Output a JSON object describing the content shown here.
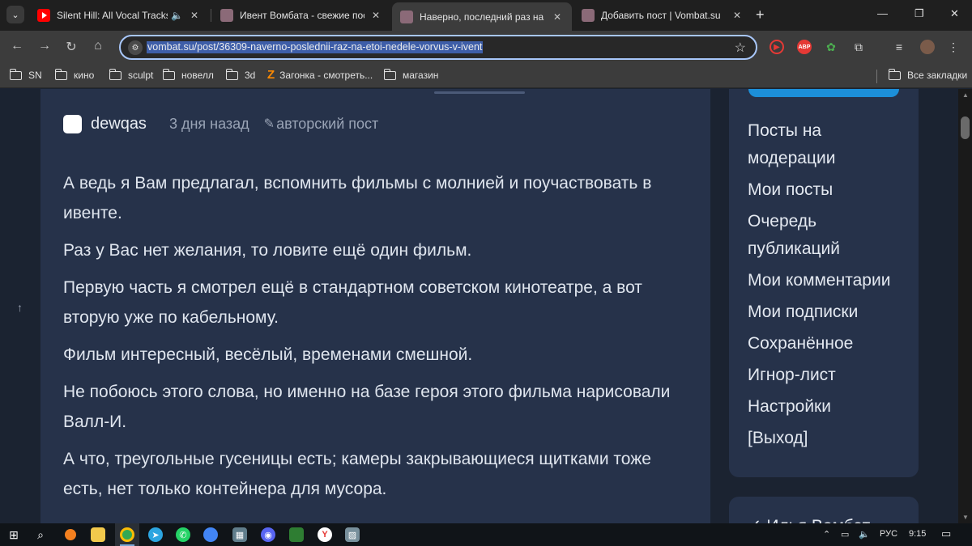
{
  "browser": {
    "tabs": [
      {
        "title": "Silent Hill: All Vocal Tracks -",
        "favicon": "youtube-icon",
        "audio": "speaker-icon"
      },
      {
        "title": "Ивент Вомбата - свежие посты",
        "favicon": "wombat-icon"
      },
      {
        "title": "Наверно, последний раз на эт",
        "favicon": "wombat-icon",
        "active": true
      },
      {
        "title": "Добавить пост | Vombat.su",
        "favicon": "wombat-icon"
      }
    ],
    "close_glyph": "✕",
    "new_tab_glyph": "+",
    "window_controls": [
      "—",
      "❐",
      "✕"
    ],
    "url": "vombat.su/post/36309-naverno-poslednii-raz-na-etoi-nedele-vorvus-v-ivent",
    "bookmarks": [
      "SN",
      "кино",
      "sculpt",
      "новелл",
      "3d",
      "Загонка - смотреть...",
      "магазин"
    ],
    "all_bookmarks": "Все закладки",
    "extensions": {
      "abp": "ABP"
    }
  },
  "post": {
    "author": "dewqas",
    "time_ago": "3 дня назад",
    "badge": "авторский пост",
    "paragraphs": [
      "А ведь я Вам предлагал, вспомнить фильмы с молнией и поучаствовать в ивенте.",
      "Раз у Вас нет желания, то ловите ещё один фильм.",
      "Первую часть я смотрел ещё в стандартном советском кинотеатре, а вот вторую уже по кабельному.",
      "Фильм интересный, весёлый, временами смешной.",
      "Не побоюсь этого слова, но именно на базе героя этого фильма нарисовали Валл-И.",
      "А что, треугольные гусеницы есть; камеры закрывающиеся щитками тоже есть, нет только контейнера для мусора."
    ]
  },
  "sidebar": {
    "menu": [
      "Посты на модерации",
      "Мои посты",
      "Очередь публикаций",
      "Мои комментарии",
      "Мои подписки",
      "Сохранённое",
      "Игнор-лист",
      "Настройки",
      "[Выход]"
    ],
    "next_block_partial": "✓ Илья Вомбат"
  },
  "taskbar": {
    "lang": "РУС",
    "time": "9:15"
  },
  "colors": {
    "page_bg": "#1b2331",
    "card_bg": "#26324a",
    "accent": "#1c8fd9",
    "url_highlight": "#3e5ea8"
  }
}
